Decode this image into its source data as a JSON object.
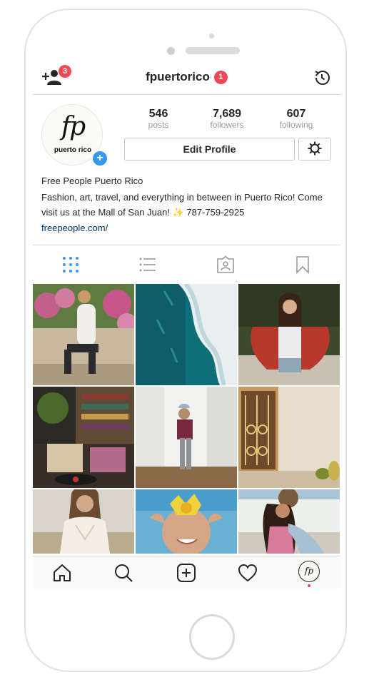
{
  "header": {
    "username": "fpuertorico",
    "username_badge": "1",
    "add_person_badge": "3",
    "add_person_icon": "add-person-icon",
    "history_icon": "history-icon"
  },
  "profile": {
    "avatar_script": "fp",
    "avatar_text": "puerto rico",
    "avatar_add": "+",
    "stats": [
      {
        "value": "546",
        "label": "posts"
      },
      {
        "value": "7,689",
        "label": "followers"
      },
      {
        "value": "607",
        "label": "following"
      }
    ],
    "edit_button": "Edit Profile",
    "settings_icon": "gear-icon"
  },
  "bio": {
    "name": "Free People Puerto Rico",
    "text": "Fashion, art, travel, and everything in between in Puerto Rico! Come visit us at the Mall of San Juan! ✨ 787-759-2925",
    "link": "freepeople.com/"
  },
  "tabs": [
    {
      "icon": "grid-icon",
      "active": true
    },
    {
      "icon": "list-icon",
      "active": false
    },
    {
      "icon": "tagged-icon",
      "active": false
    },
    {
      "icon": "bookmark-icon",
      "active": false
    }
  ],
  "tabbar": [
    {
      "icon": "home-icon"
    },
    {
      "icon": "search-icon"
    },
    {
      "icon": "new-post-icon"
    },
    {
      "icon": "heart-icon"
    },
    {
      "icon": "profile-avatar",
      "label": "fp"
    }
  ],
  "colors": {
    "accent": "#3897f0",
    "badge": "#ed4956",
    "link": "#003569",
    "text": "#262626",
    "muted": "#999999"
  }
}
